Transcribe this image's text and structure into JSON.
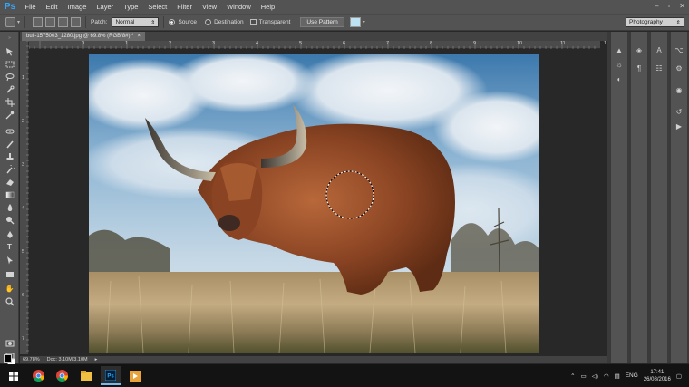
{
  "app": {
    "logo": "Ps",
    "accent": "#31a8ff"
  },
  "menu": [
    "File",
    "Edit",
    "Image",
    "Layer",
    "Type",
    "Select",
    "Filter",
    "View",
    "Window",
    "Help"
  ],
  "options": {
    "patch_label": "Patch:",
    "patch_mode": "Normal",
    "source_label": "Source",
    "destination_label": "Destination",
    "transparent_label": "Transparent",
    "use_pattern_label": "Use Pattern",
    "selected_radio": "source"
  },
  "workspace": "Photography",
  "document": {
    "tab_title": "bull-1575003_1280.jpg @ 69.8% (RGB/8#) *",
    "close_glyph": "×"
  },
  "ruler": {
    "top": [
      "0",
      "1",
      "2",
      "3",
      "4",
      "5",
      "6",
      "7",
      "8",
      "9",
      "10",
      "11",
      "12"
    ],
    "left": [
      "1",
      "2",
      "3",
      "4",
      "5",
      "6",
      "7"
    ]
  },
  "status": {
    "zoom": "69.78%",
    "doc_size": "Doc: 3.10M/3.10M"
  },
  "tools": [
    "move-tool",
    "marquee-tool",
    "lasso-tool",
    "quick-select-tool",
    "crop-tool",
    "eyedropper-tool",
    "healing-brush-tool",
    "brush-tool",
    "clone-stamp-tool",
    "history-brush-tool",
    "eraser-tool",
    "gradient-tool",
    "blur-tool",
    "dodge-tool",
    "pen-tool",
    "type-tool",
    "path-select-tool",
    "rectangle-tool",
    "hand-tool",
    "zoom-tool",
    "edit-toolbar",
    "quick-mask",
    "screen-mode"
  ],
  "colors": {
    "foreground": "#000000",
    "background": "#ffffff",
    "pattern_swatch": "#bde2f2"
  },
  "taskbar": {
    "apps": [
      "windows-start",
      "chrome-1",
      "chrome-2",
      "file-explorer",
      "photoshop",
      "media-app"
    ],
    "language": "ENG",
    "time": "17:41",
    "date": "26/08/2016"
  }
}
